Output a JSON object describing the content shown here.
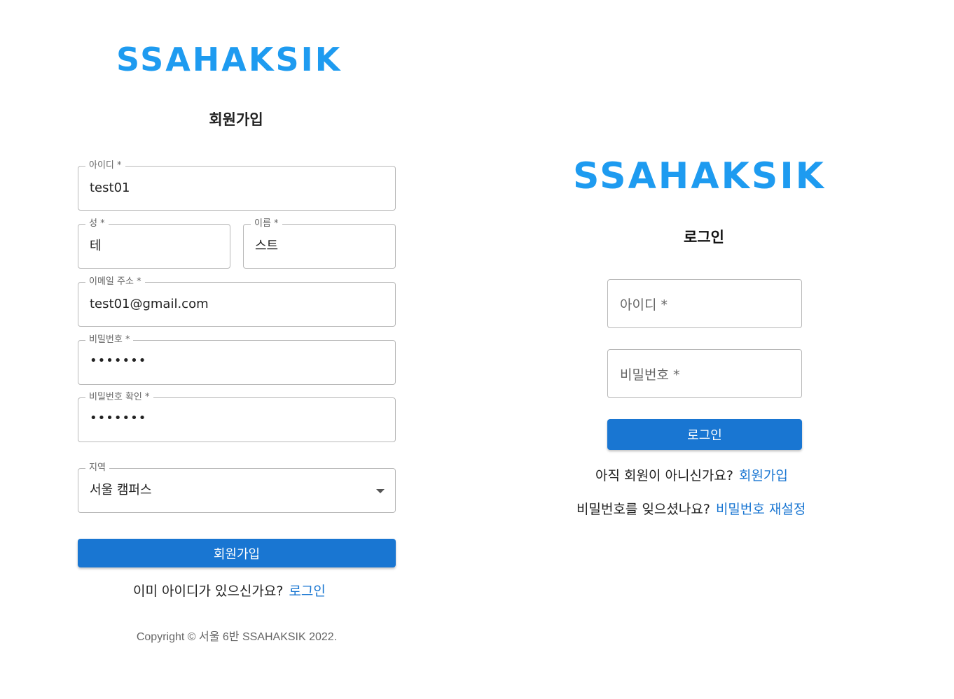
{
  "brand": {
    "logo_text": "SSAHAKSIK",
    "color": "#1e9bf0"
  },
  "signup": {
    "title": "회원가입",
    "fields": {
      "username": {
        "label": "아이디 *",
        "value": "test01"
      },
      "last_name": {
        "label": "성 *",
        "value": "테"
      },
      "first_name": {
        "label": "이름 *",
        "value": "스트"
      },
      "email": {
        "label": "이메일 주소 *",
        "value": "test01@gmail.com"
      },
      "password": {
        "label": "비밀번호 *",
        "value": "•••••••"
      },
      "password_confirm": {
        "label": "비밀번호 확인 *",
        "value": "•••••••"
      },
      "region": {
        "label": "지역",
        "value": "서울 캠퍼스"
      }
    },
    "submit_label": "회원가입",
    "login_prompt": "이미 아이디가 있으신가요?",
    "login_link": "로그인",
    "copyright": "Copyright © 서울 6반 SSAHAKSIK 2022."
  },
  "login": {
    "title": "로그인",
    "username_placeholder": "아이디 *",
    "password_placeholder": "비밀번호 *",
    "submit_label": "로그인",
    "signup_prompt": "아직 회원이 아니신가요?",
    "signup_link": "회원가입",
    "reset_prompt": "비밀번호를 잊으셨나요?",
    "reset_link": "비밀번호 재설정"
  },
  "colors": {
    "primary": "#1976d2",
    "logo": "#1e9bf0",
    "border": "#b8b8b8"
  }
}
